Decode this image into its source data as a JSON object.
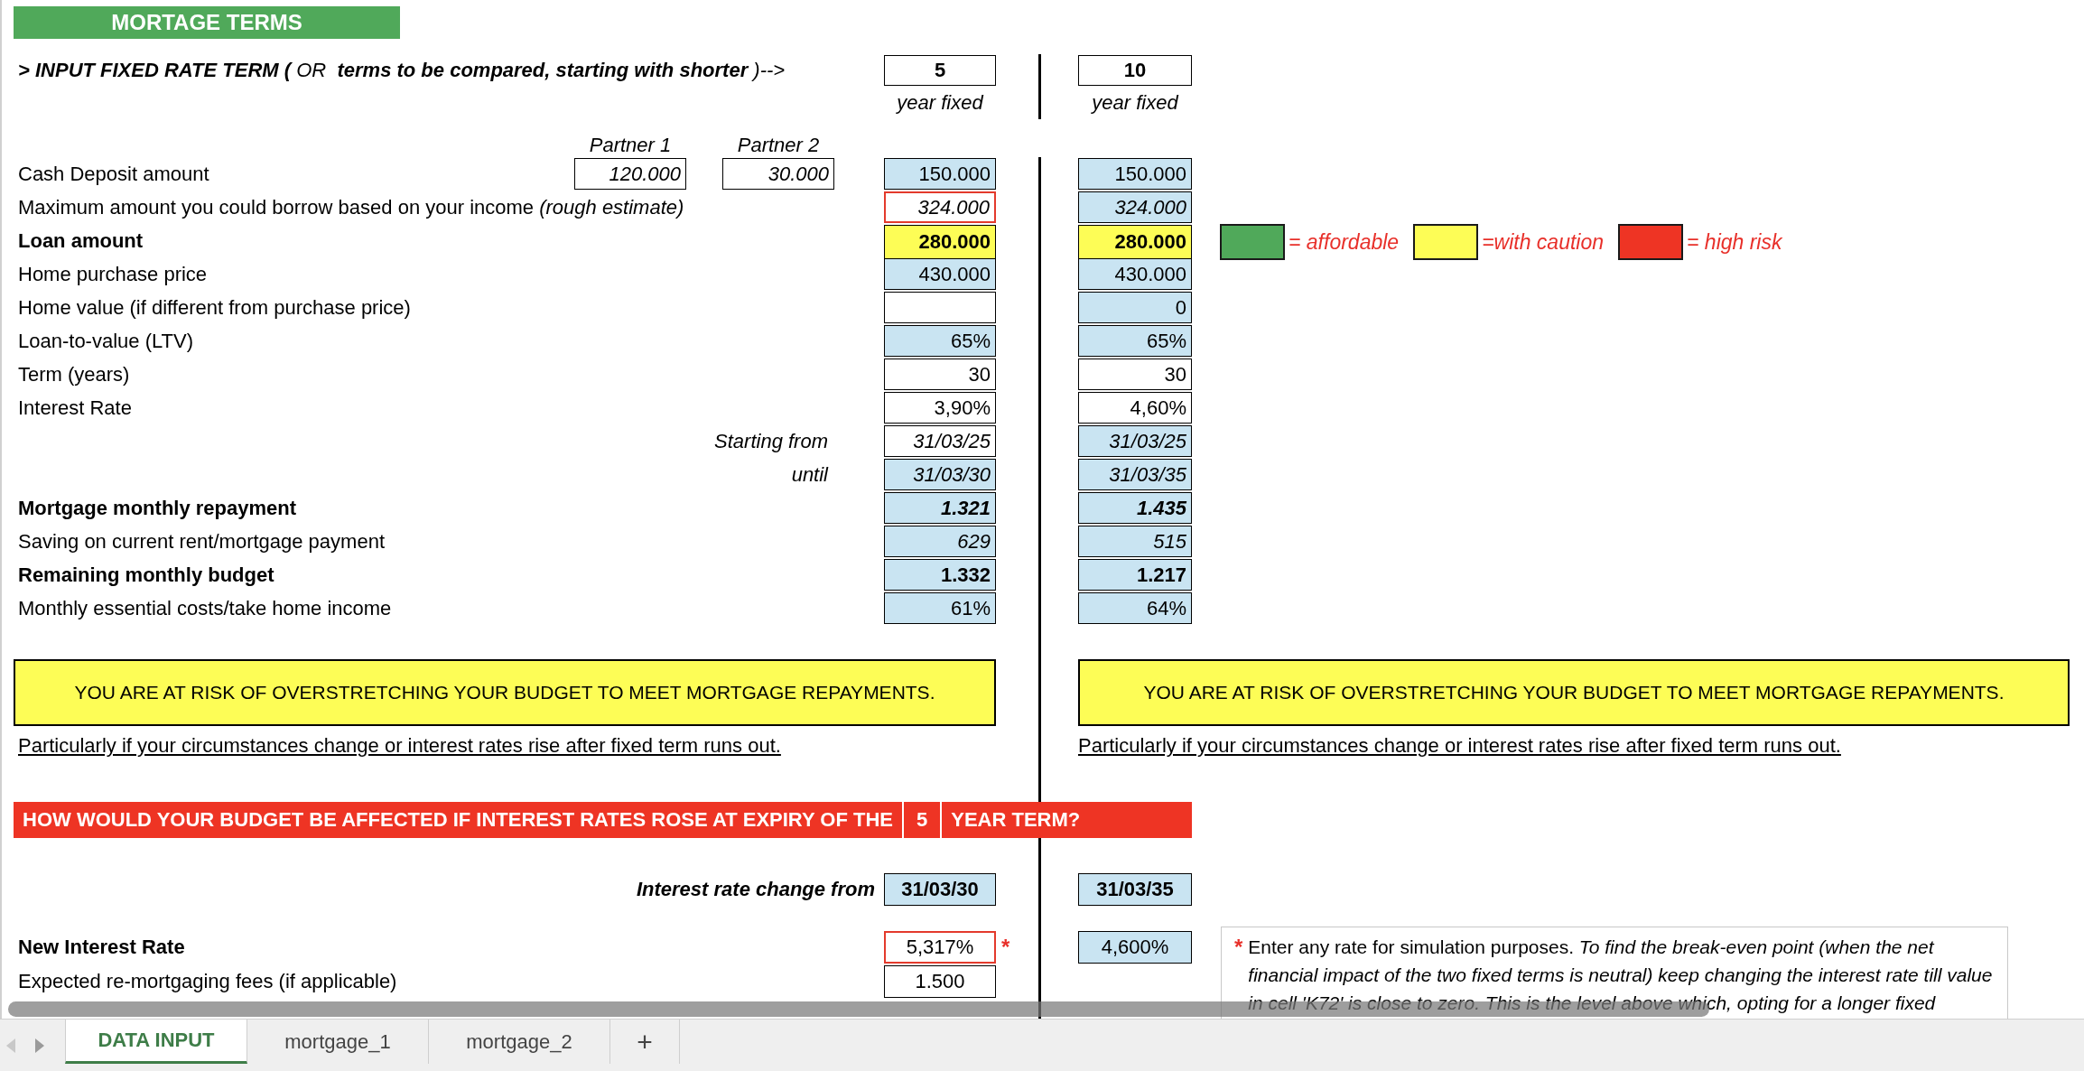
{
  "title": "MORTAGE TERMS",
  "term_input": {
    "label": "**> INPUT FIXED RATE TERM (** OR  **terms to be compared, starting with shorter** )-->",
    "terms": [
      "5",
      "10"
    ],
    "caption": [
      "year fixed",
      "year fixed"
    ]
  },
  "partners": [
    "Partner 1",
    "Partner 2"
  ],
  "rows": [
    {
      "label": "Cash Deposit amount",
      "partners": [
        "120.000",
        "30.000"
      ],
      "values": [
        {
          "text": "150.000",
          "kind": "computed"
        },
        {
          "text": "150.000",
          "kind": "computed"
        }
      ]
    },
    {
      "label": "Maximum amount you could borrow based on your income *(rough estimate)*",
      "values": [
        {
          "text": "324.000",
          "kind": "flagged"
        },
        {
          "text": "324.000",
          "kind": "computed"
        }
      ]
    },
    {
      "label": "Loan amount",
      "values": [
        {
          "text": "280.000",
          "kind": "status"
        },
        {
          "text": "280.000",
          "kind": "status"
        }
      ]
    },
    {
      "label": "Home purchase price",
      "values": [
        {
          "text": "430.000",
          "kind": "computed"
        },
        {
          "text": "430.000",
          "kind": "computed"
        }
      ]
    },
    {
      "label": "Home value (if different from purchase price)",
      "values": [
        {
          "kind": "input"
        },
        {
          "text": "0",
          "kind": "computed"
        }
      ]
    },
    {
      "label": "Loan-to-value (LTV)",
      "values": [
        {
          "text": "65%",
          "kind": "computed"
        },
        {
          "text": "65%",
          "kind": "computed"
        }
      ]
    },
    {
      "label": "Term (years)",
      "values": [
        {
          "text": "30",
          "kind": "input"
        },
        {
          "text": "30",
          "kind": "input"
        }
      ]
    },
    {
      "label": "Interest Rate",
      "values": [
        {
          "text": "3,90%",
          "kind": "input"
        },
        {
          "text": "4,60%",
          "kind": "input"
        }
      ]
    },
    {
      "label": "Starting from",
      "values": [
        {
          "text": "31/03/25",
          "kind": "input"
        },
        {
          "text": "31/03/25",
          "kind": "computed"
        }
      ]
    },
    {
      "label": "until",
      "values": [
        {
          "text": "31/03/30",
          "kind": "computed"
        },
        {
          "text": "31/03/35",
          "kind": "computed"
        }
      ]
    },
    {
      "label": "Mortgage monthly repayment",
      "values": [
        {
          "text": "1.321",
          "kind": "computed"
        },
        {
          "text": "1.435",
          "kind": "computed"
        }
      ]
    },
    {
      "label": "Saving on current rent/mortgage payment",
      "values": [
        {
          "text": "629",
          "kind": "computed"
        },
        {
          "text": "515",
          "kind": "computed"
        }
      ]
    },
    {
      "label": "Remaining monthly budget",
      "values": [
        {
          "text": "1.332",
          "kind": "computed"
        },
        {
          "text": "1.217",
          "kind": "computed"
        }
      ]
    },
    {
      "label": "Monthly essential costs/take home income",
      "values": [
        {
          "text": "61%",
          "kind": "computed"
        },
        {
          "text": "64%",
          "kind": "computed"
        }
      ]
    }
  ],
  "legend": [
    {
      "color": "#50a95a",
      "label": "= affordable"
    },
    {
      "color": "#fdfd56",
      "label": "=with caution"
    },
    {
      "color": "#ee3424",
      "label": "= high risk"
    }
  ],
  "banners": [
    {
      "text": "YOU ARE AT RISK OF OVERSTRETCHING YOUR BUDGET TO MEET MORTGAGE REPAYMENTS.",
      "link": "Particularly if your circumstances change or interest rates rise after fixed term runs out."
    },
    {
      "text": "YOU ARE AT RISK OF OVERSTRETCHING YOUR BUDGET TO MEET MORTGAGE REPAYMENTS.",
      "link": "Particularly if your circumstances change or interest rates rise after fixed term runs out."
    }
  ],
  "heading": {
    "before": "HOW WOULD YOUR BUDGET BE AFFECTED IF INTEREST RATES ROSE AT EXPIRY OF THE",
    "term": "5",
    "after": "YEAR TERM?"
  },
  "simulation": {
    "change_label": "Interest rate change from",
    "change_dates": [
      "31/03/30",
      "31/03/35"
    ],
    "rate_label": "New Interest Rate",
    "rates": [
      {
        "text": "5,317%",
        "kind": "flagged"
      },
      {
        "text": "4,600%",
        "kind": "computed"
      }
    ],
    "rate_marker": "*",
    "fees_label": "Expected re-mortgaging fees (if applicable)",
    "fees": "1.500",
    "note": {
      "marker": "*",
      "text": "Enter any rate for simulation purposes. *To find the break-even point (when the net financial impact of the two fixed terms is neutral) keep changing the interest rate till value in cell 'K72' is close to zero. This is the level above which, opting for a longer fixed*"
    }
  },
  "tabs": [
    {
      "label": "DATA INPUT",
      "selected": true
    },
    {
      "label": "mortgage_1",
      "selected": false
    },
    {
      "label": "mortgage_2",
      "selected": false
    }
  ],
  "add_tab": "+"
}
